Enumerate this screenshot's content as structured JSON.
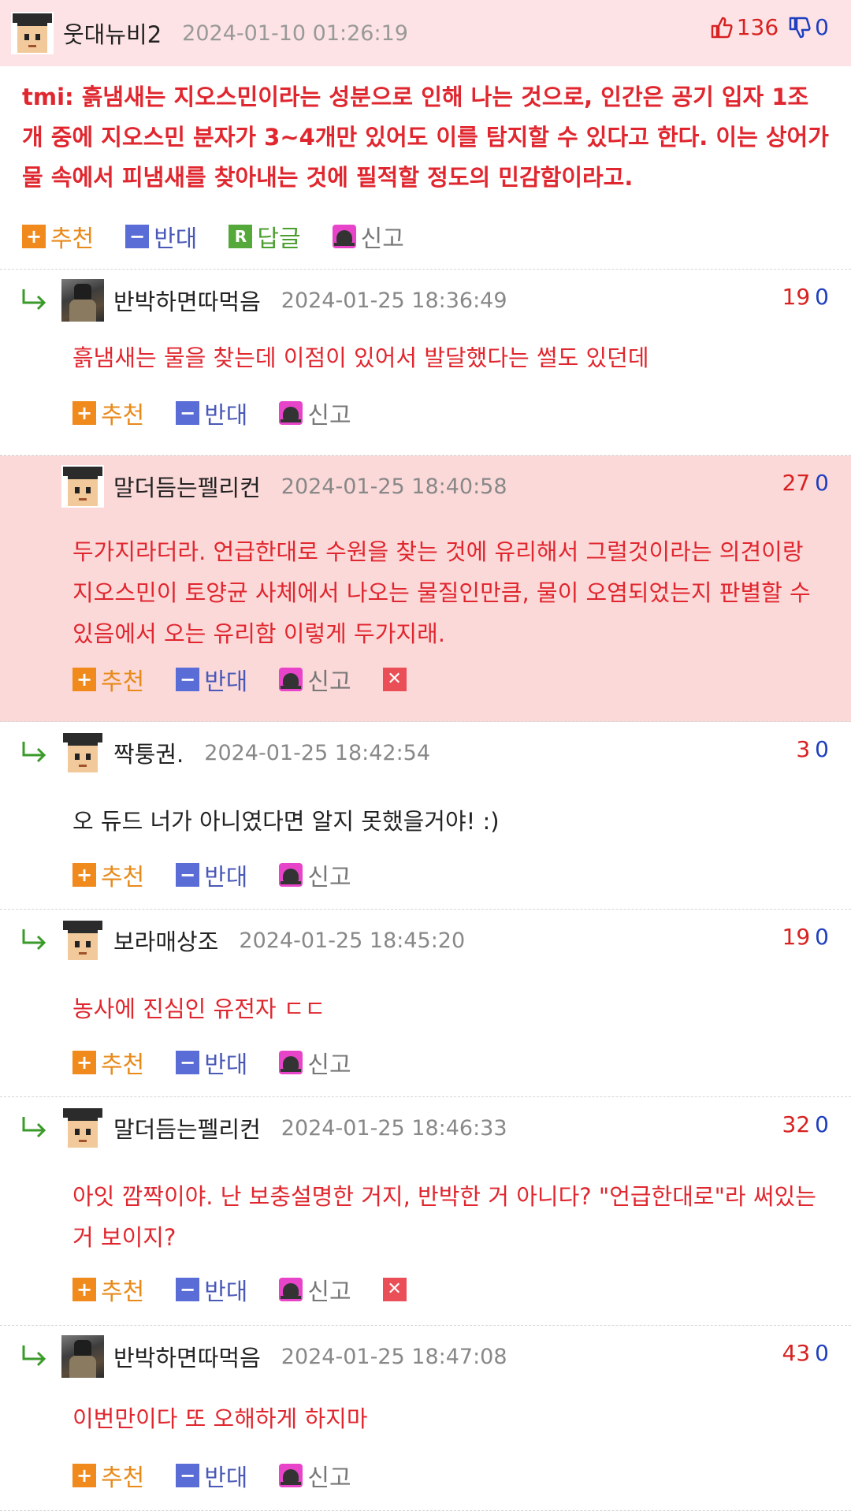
{
  "post": {
    "author": "웃대뉴비2",
    "datetime": "2024-01-10 01:26:19",
    "up_votes": "136",
    "down_votes": "0",
    "body": "tmi: 흙냄새는 지오스민이라는 성분으로 인해 나는 것으로, 인간은 공기 입자 1조 개 중에 지오스민 분자가 3~4개만 있어도 이를 탐지할 수 있다고 한다. 이는 상어가 물 속에서 피냄새를 찾아내는 것에 필적할 정도의 민감함이라고.",
    "actions": {
      "recommend": "추천",
      "oppose": "반대",
      "reply": "답글",
      "report": "신고"
    }
  },
  "labels": {
    "recommend": "추천",
    "oppose": "반대",
    "report": "신고"
  },
  "colors": {
    "highlight_bg": "#fcd9d9",
    "post_head_bg": "#fde3e5",
    "accent_red": "#e0262e",
    "down_blue": "#1f3fbf"
  },
  "comments": [
    {
      "author": "반박하면따먹음",
      "avatar": "knight-avatar",
      "datetime": "2024-01-25 18:36:49",
      "up": "19",
      "down": "0",
      "body": "흙냄새는 물을 찾는데 이점이 있어서 발달했다는 썰도 있던데",
      "highlighted": false,
      "deletable": false
    },
    {
      "author": "말더듬는펠리컨",
      "avatar": "pixel-avatar",
      "datetime": "2024-01-25 18:40:58",
      "up": "27",
      "down": "0",
      "body": "두가지라더라. 언급한대로 수원을 찾는 것에 유리해서 그럴것이라는 의견이랑 지오스민이 토양균 사체에서 나오는 물질인만큼, 물이 오염되었는지 판별할 수 있음에서 오는 유리함 이렇게 두가지래.",
      "highlighted": true,
      "deletable": true
    },
    {
      "author": "짝퉁권.",
      "avatar": "pixel-avatar",
      "datetime": "2024-01-25 18:42:54",
      "up": "3",
      "down": "0",
      "body": "오 듀드 너가 아니였다면 알지 못했을거야! :)",
      "highlighted": false,
      "deletable": false
    },
    {
      "author": "보라매상조",
      "avatar": "pixel-avatar",
      "datetime": "2024-01-25 18:45:20",
      "up": "19",
      "down": "0",
      "body": "농사에 진심인 유전자 ㄷㄷ",
      "highlighted": false,
      "deletable": false
    },
    {
      "author": "말더듬는펠리컨",
      "avatar": "pixel-avatar",
      "datetime": "2024-01-25 18:46:33",
      "up": "32",
      "down": "0",
      "body": "아잇 깜짝이야. 난 보충설명한 거지, 반박한 거 아니다? \"언급한대로\"라 써있는 거 보이지?",
      "highlighted": false,
      "deletable": true
    },
    {
      "author": "반박하면따먹음",
      "avatar": "knight-avatar",
      "datetime": "2024-01-25 18:47:08",
      "up": "43",
      "down": "0",
      "body": "이번만이다 또 오해하게 하지마",
      "highlighted": false,
      "deletable": false
    }
  ]
}
